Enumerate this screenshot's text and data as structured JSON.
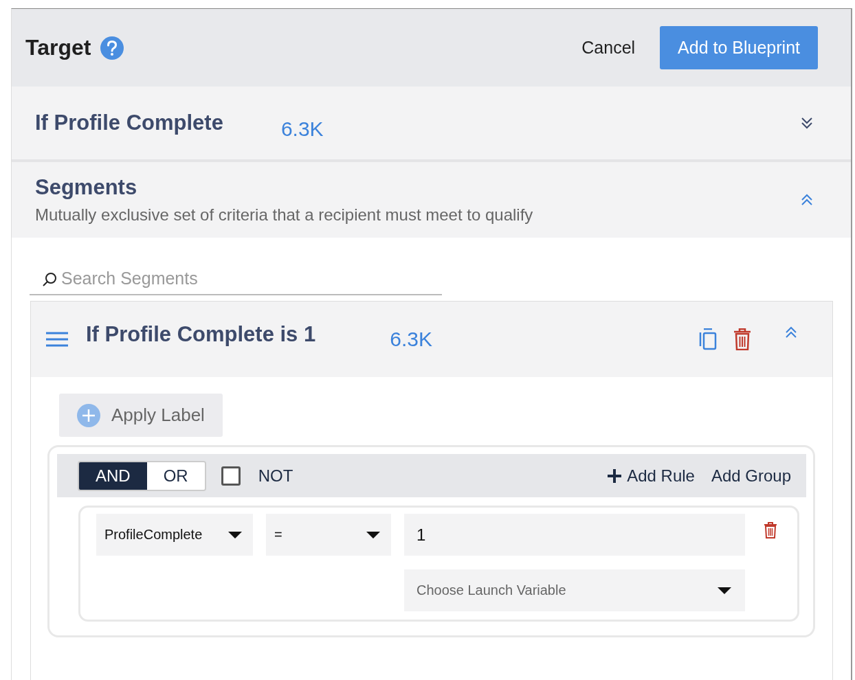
{
  "header": {
    "title": "Target",
    "cancel": "Cancel",
    "primary": "Add to Blueprint"
  },
  "sections": [
    {
      "title": "If Profile Complete",
      "count": "6.3K",
      "expanded": false
    },
    {
      "title": "Segments",
      "subtitle": "Mutually exclusive set of criteria that a recipient must meet to qualify",
      "expanded": true
    }
  ],
  "search": {
    "placeholder": "Search Segments"
  },
  "segments": [
    {
      "title": "If Profile Complete is 1",
      "count": "6.3K",
      "expanded": true,
      "apply_label": "Apply Label",
      "group": {
        "operators": [
          {
            "label": "AND",
            "selected": true
          },
          {
            "label": "OR",
            "selected": false
          }
        ],
        "not": {
          "label": "NOT",
          "checked": false
        },
        "add_rule": "Add Rule",
        "add_group": "Add Group",
        "rules": [
          {
            "field": "ProfileComplete",
            "operator": "=",
            "value": "1",
            "launch_variable": {
              "placeholder": "Choose Launch Variable"
            }
          }
        ]
      }
    }
  ]
}
